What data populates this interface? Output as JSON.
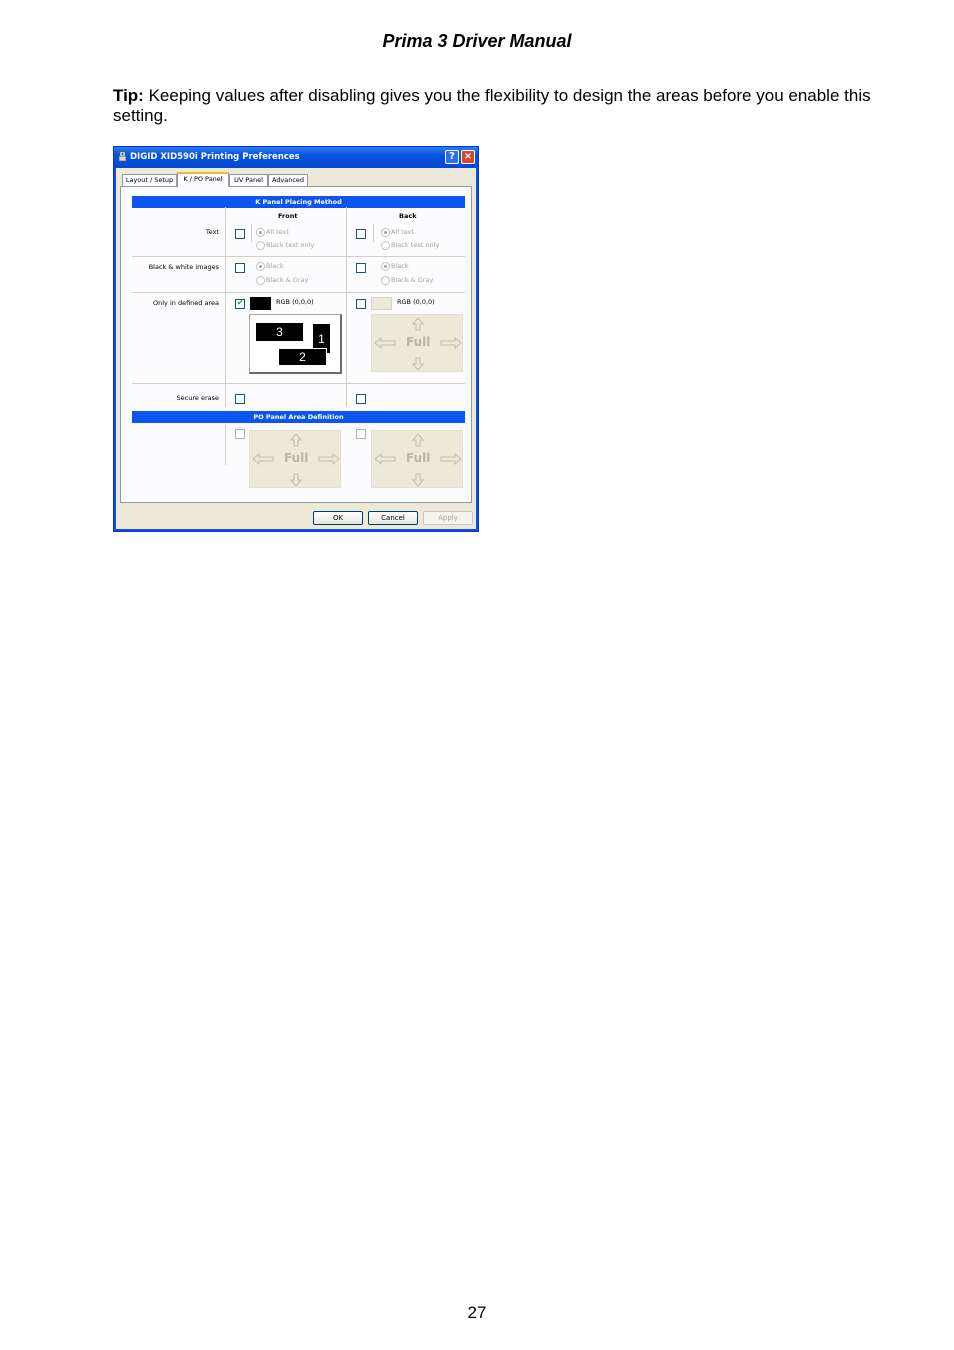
{
  "doc": {
    "header": "Prima 3 Driver Manual",
    "tip_label": "Tip:",
    "tip_text": " Keeping values after disabling gives you the flexibility to design the areas before you enable this setting.",
    "page_number": "27"
  },
  "dialog": {
    "title": "DIGID XID590i Printing Preferences",
    "help_button": "?",
    "close_button": "×",
    "tabs": [
      "Layout / Setup",
      "K / PO Panel",
      "UV Panel",
      "Advanced"
    ],
    "active_tab": "K / PO Panel",
    "k_panel": {
      "heading": "K Panel Placing Method",
      "col_front": "Front",
      "col_back": "Back",
      "text_row": {
        "label": "Text",
        "front_checked": false,
        "back_checked": false,
        "front_opt1": "All text",
        "front_opt2": "Black text only",
        "back_opt1": "All text",
        "back_opt2": "Black text only"
      },
      "bw_row": {
        "label": "Black & white images",
        "front_checked": false,
        "back_checked": false,
        "front_opt1": "Black",
        "front_opt2": "Black & Gray",
        "back_opt1": "Black",
        "back_opt2": "Black & Gray"
      },
      "defined_row": {
        "label": "Only in defined area",
        "front_checked": true,
        "back_checked": false,
        "front_rgb": "RGB (0,0,0)",
        "back_rgb": "RGB (0,0,0)",
        "front_color": "#000000",
        "back_color": "#ece9d8",
        "preview_labels": [
          "3",
          "1",
          "2"
        ],
        "back_area_label": "Full"
      },
      "secure_row": {
        "label": "Secure erase",
        "front_checked": false,
        "back_checked": false
      }
    },
    "po_panel": {
      "heading": "PO Panel Area Definition",
      "front_checked": false,
      "back_checked": false,
      "front_area_label": "Full",
      "back_area_label": "Full"
    },
    "buttons": {
      "ok": "OK",
      "cancel": "Cancel",
      "apply": "Apply"
    }
  }
}
